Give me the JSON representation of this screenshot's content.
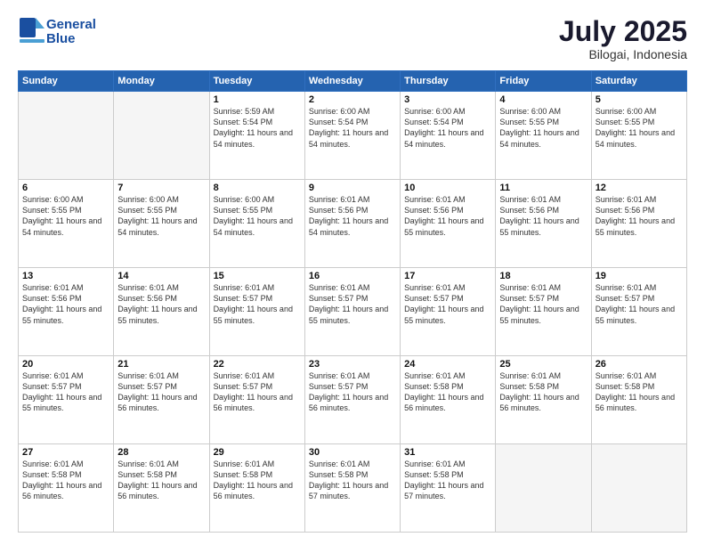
{
  "header": {
    "logo_line1": "General",
    "logo_line2": "Blue",
    "month": "July 2025",
    "location": "Bilogai, Indonesia"
  },
  "weekdays": [
    "Sunday",
    "Monday",
    "Tuesday",
    "Wednesday",
    "Thursday",
    "Friday",
    "Saturday"
  ],
  "weeks": [
    [
      {
        "day": "",
        "info": ""
      },
      {
        "day": "",
        "info": ""
      },
      {
        "day": "1",
        "info": "Sunrise: 5:59 AM\nSunset: 5:54 PM\nDaylight: 11 hours and 54 minutes."
      },
      {
        "day": "2",
        "info": "Sunrise: 6:00 AM\nSunset: 5:54 PM\nDaylight: 11 hours and 54 minutes."
      },
      {
        "day": "3",
        "info": "Sunrise: 6:00 AM\nSunset: 5:54 PM\nDaylight: 11 hours and 54 minutes."
      },
      {
        "day": "4",
        "info": "Sunrise: 6:00 AM\nSunset: 5:55 PM\nDaylight: 11 hours and 54 minutes."
      },
      {
        "day": "5",
        "info": "Sunrise: 6:00 AM\nSunset: 5:55 PM\nDaylight: 11 hours and 54 minutes."
      }
    ],
    [
      {
        "day": "6",
        "info": "Sunrise: 6:00 AM\nSunset: 5:55 PM\nDaylight: 11 hours and 54 minutes."
      },
      {
        "day": "7",
        "info": "Sunrise: 6:00 AM\nSunset: 5:55 PM\nDaylight: 11 hours and 54 minutes."
      },
      {
        "day": "8",
        "info": "Sunrise: 6:00 AM\nSunset: 5:55 PM\nDaylight: 11 hours and 54 minutes."
      },
      {
        "day": "9",
        "info": "Sunrise: 6:01 AM\nSunset: 5:56 PM\nDaylight: 11 hours and 54 minutes."
      },
      {
        "day": "10",
        "info": "Sunrise: 6:01 AM\nSunset: 5:56 PM\nDaylight: 11 hours and 55 minutes."
      },
      {
        "day": "11",
        "info": "Sunrise: 6:01 AM\nSunset: 5:56 PM\nDaylight: 11 hours and 55 minutes."
      },
      {
        "day": "12",
        "info": "Sunrise: 6:01 AM\nSunset: 5:56 PM\nDaylight: 11 hours and 55 minutes."
      }
    ],
    [
      {
        "day": "13",
        "info": "Sunrise: 6:01 AM\nSunset: 5:56 PM\nDaylight: 11 hours and 55 minutes."
      },
      {
        "day": "14",
        "info": "Sunrise: 6:01 AM\nSunset: 5:56 PM\nDaylight: 11 hours and 55 minutes."
      },
      {
        "day": "15",
        "info": "Sunrise: 6:01 AM\nSunset: 5:57 PM\nDaylight: 11 hours and 55 minutes."
      },
      {
        "day": "16",
        "info": "Sunrise: 6:01 AM\nSunset: 5:57 PM\nDaylight: 11 hours and 55 minutes."
      },
      {
        "day": "17",
        "info": "Sunrise: 6:01 AM\nSunset: 5:57 PM\nDaylight: 11 hours and 55 minutes."
      },
      {
        "day": "18",
        "info": "Sunrise: 6:01 AM\nSunset: 5:57 PM\nDaylight: 11 hours and 55 minutes."
      },
      {
        "day": "19",
        "info": "Sunrise: 6:01 AM\nSunset: 5:57 PM\nDaylight: 11 hours and 55 minutes."
      }
    ],
    [
      {
        "day": "20",
        "info": "Sunrise: 6:01 AM\nSunset: 5:57 PM\nDaylight: 11 hours and 55 minutes."
      },
      {
        "day": "21",
        "info": "Sunrise: 6:01 AM\nSunset: 5:57 PM\nDaylight: 11 hours and 56 minutes."
      },
      {
        "day": "22",
        "info": "Sunrise: 6:01 AM\nSunset: 5:57 PM\nDaylight: 11 hours and 56 minutes."
      },
      {
        "day": "23",
        "info": "Sunrise: 6:01 AM\nSunset: 5:57 PM\nDaylight: 11 hours and 56 minutes."
      },
      {
        "day": "24",
        "info": "Sunrise: 6:01 AM\nSunset: 5:58 PM\nDaylight: 11 hours and 56 minutes."
      },
      {
        "day": "25",
        "info": "Sunrise: 6:01 AM\nSunset: 5:58 PM\nDaylight: 11 hours and 56 minutes."
      },
      {
        "day": "26",
        "info": "Sunrise: 6:01 AM\nSunset: 5:58 PM\nDaylight: 11 hours and 56 minutes."
      }
    ],
    [
      {
        "day": "27",
        "info": "Sunrise: 6:01 AM\nSunset: 5:58 PM\nDaylight: 11 hours and 56 minutes."
      },
      {
        "day": "28",
        "info": "Sunrise: 6:01 AM\nSunset: 5:58 PM\nDaylight: 11 hours and 56 minutes."
      },
      {
        "day": "29",
        "info": "Sunrise: 6:01 AM\nSunset: 5:58 PM\nDaylight: 11 hours and 56 minutes."
      },
      {
        "day": "30",
        "info": "Sunrise: 6:01 AM\nSunset: 5:58 PM\nDaylight: 11 hours and 57 minutes."
      },
      {
        "day": "31",
        "info": "Sunrise: 6:01 AM\nSunset: 5:58 PM\nDaylight: 11 hours and 57 minutes."
      },
      {
        "day": "",
        "info": ""
      },
      {
        "day": "",
        "info": ""
      }
    ]
  ]
}
